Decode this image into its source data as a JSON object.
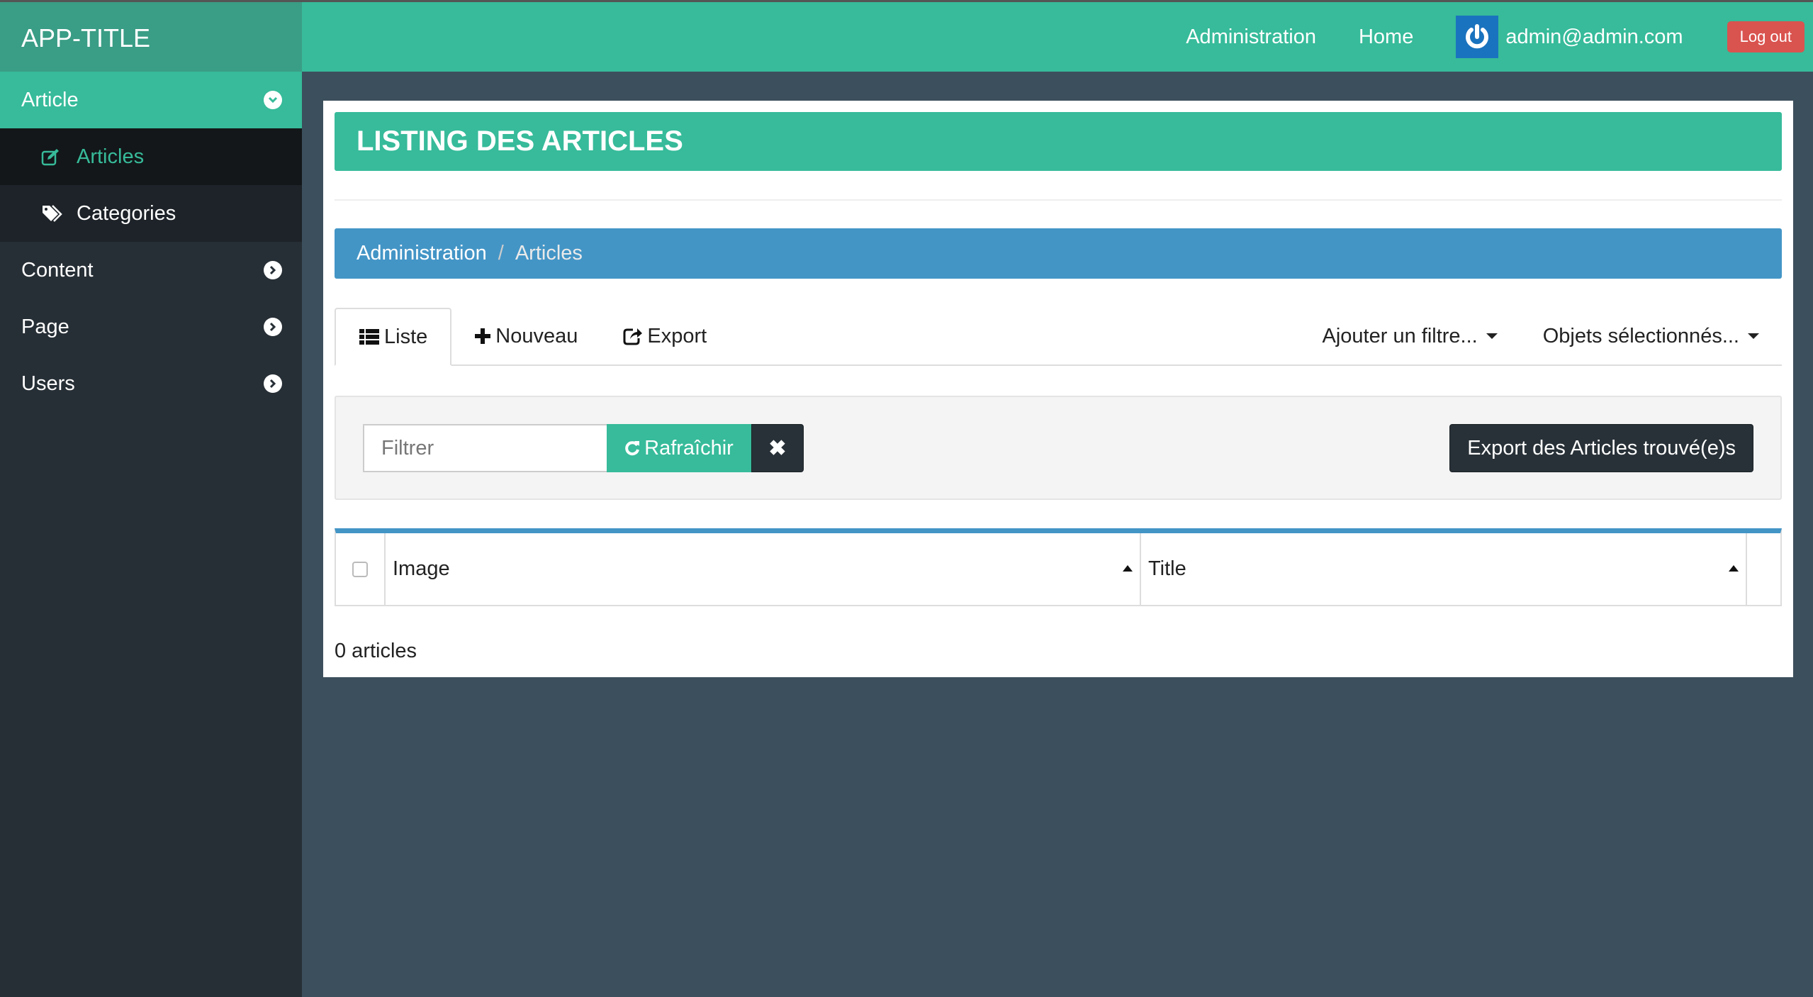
{
  "app": {
    "title": "APP-TITLE"
  },
  "sidebar": {
    "groups": [
      {
        "label": "Article",
        "icon": "chevron-down-circle-icon",
        "expanded": true,
        "children": [
          {
            "label": "Articles",
            "icon": "edit-icon",
            "current": true
          },
          {
            "label": "Categories",
            "icon": "tags-icon",
            "current": false
          }
        ]
      },
      {
        "label": "Content",
        "icon": "chevron-right-circle-icon",
        "expanded": false
      },
      {
        "label": "Page",
        "icon": "chevron-right-circle-icon",
        "expanded": false
      },
      {
        "label": "Users",
        "icon": "chevron-right-circle-icon",
        "expanded": false
      }
    ]
  },
  "header": {
    "links": [
      "Administration",
      "Home"
    ],
    "user": {
      "email": "admin@admin.com",
      "avatar_icon": "power-icon"
    },
    "logout_label": "Log out"
  },
  "page": {
    "title": "LISTING DES ARTICLES",
    "breadcrumb": [
      {
        "label": "Administration"
      },
      {
        "label": "Articles"
      }
    ],
    "breadcrumb_separator": "/",
    "tabs": [
      {
        "label": "Liste",
        "icon": "list-icon",
        "active": true
      },
      {
        "label": "Nouveau",
        "icon": "plus-icon",
        "active": false
      },
      {
        "label": "Export",
        "icon": "share-icon",
        "active": false
      }
    ],
    "dropdowns": [
      {
        "label": "Ajouter un filtre..."
      },
      {
        "label": "Objets sélectionnés..."
      }
    ],
    "filter": {
      "placeholder": "Filtrer",
      "value": "",
      "refresh_label": "Rafraîchir",
      "clear_label": "✖",
      "export_label": "Export des Articles trouvé(e)s"
    },
    "table": {
      "columns": [
        {
          "label": "Image",
          "sortable": true
        },
        {
          "label": "Title",
          "sortable": true
        }
      ],
      "rows": []
    },
    "count_text": "0 articles"
  },
  "colors": {
    "accent": "#37bb9a",
    "brand_bg": "#3a9d85",
    "sidebar_bg": "#272f36",
    "content_bg": "#3c4f5c",
    "breadcrumb_bg": "#4395c6",
    "danger": "#d9534f",
    "dark_button": "#283137"
  }
}
